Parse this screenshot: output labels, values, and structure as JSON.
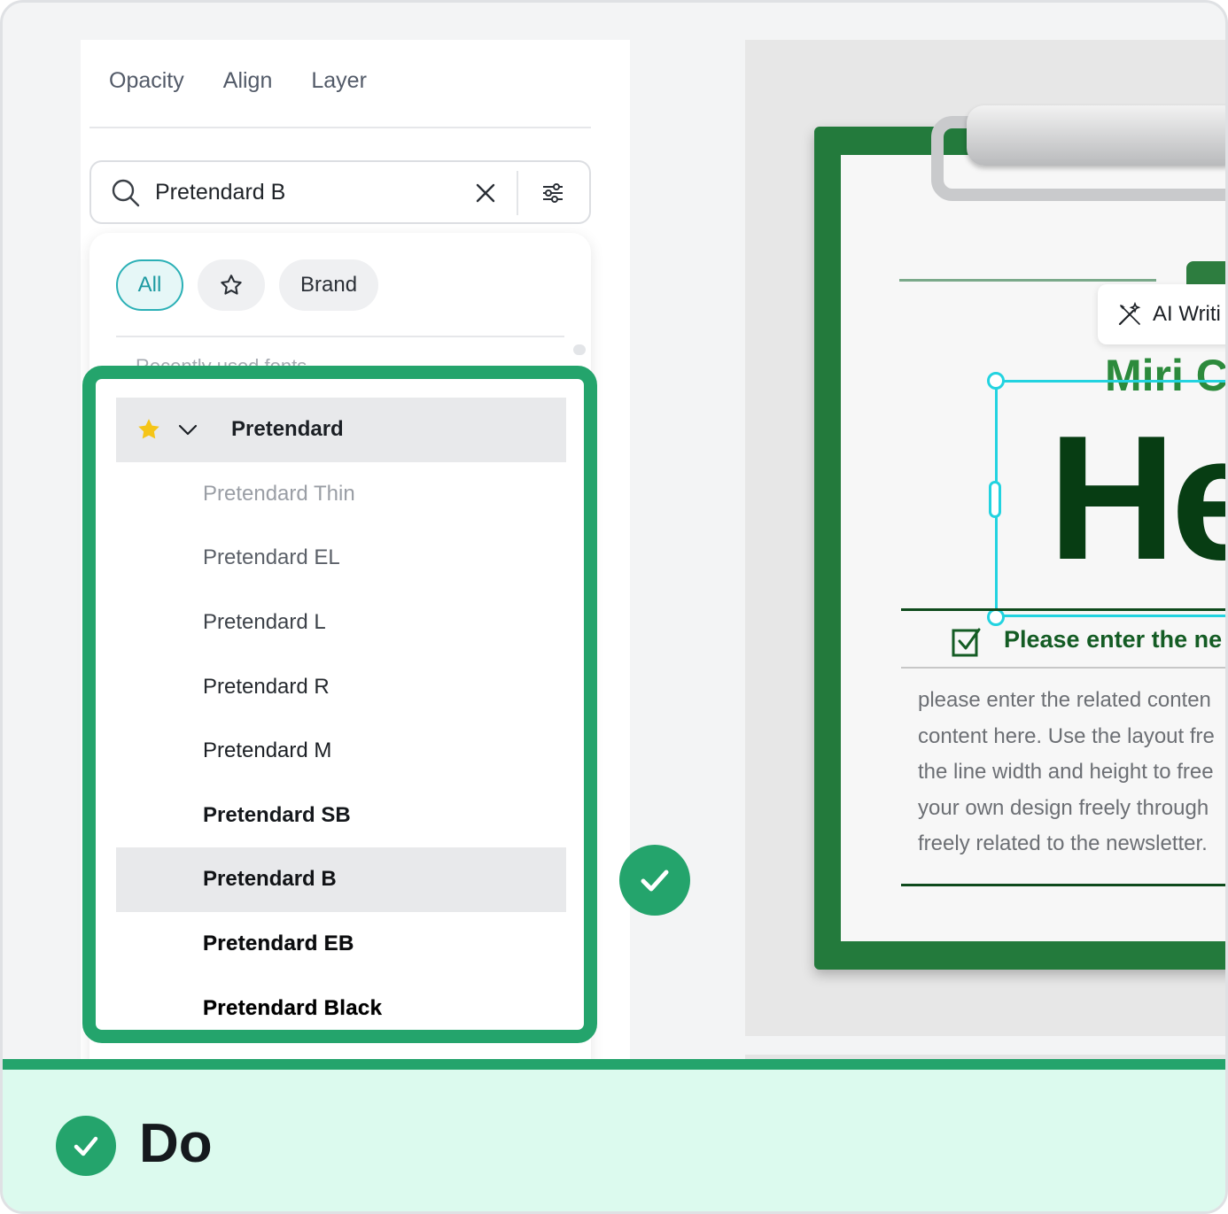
{
  "panel": {
    "tabs": [
      "Opacity",
      "Align",
      "Layer"
    ],
    "search": {
      "value": "Pretendard B"
    },
    "filter_chips": {
      "all": "All",
      "brand": "Brand"
    },
    "peek_text": "Recently used fonts",
    "font_group": "Pretendard",
    "fonts": [
      {
        "label": "Pretendard Thin",
        "color": "#9a9ea5"
      },
      {
        "label": "Pretendard EL",
        "color": "#5b6068"
      },
      {
        "label": "Pretendard L",
        "color": "#3d4249"
      },
      {
        "label": "Pretendard R",
        "color": "#25292e"
      },
      {
        "label": "Pretendard M",
        "color": "#1b1f24"
      },
      {
        "label": "Pretendard SB",
        "color": "#15181c"
      },
      {
        "label": "Pretendard B",
        "color": "#111316",
        "selected": true
      },
      {
        "label": "Pretendard EB",
        "color": "#0b0c0e"
      },
      {
        "label": "Pretendard Black",
        "color": "#000000"
      }
    ]
  },
  "canvas": {
    "ai_button": "AI Writi",
    "subtitle": "Miri Cc",
    "headline": "He",
    "section_title": "Please enter the ne",
    "body_lines": [
      "please enter the related conten",
      "content here. Use the layout fre",
      "the line width and height to free",
      "your own design freely through",
      "freely related to the newsletter."
    ]
  },
  "banner": {
    "label": "Do"
  },
  "colors": {
    "accent_green": "#24a46c",
    "selection_cyan": "#22d3e0",
    "chip_all_teal": "#2bb0b6",
    "star_yellow": "#f5c518"
  }
}
